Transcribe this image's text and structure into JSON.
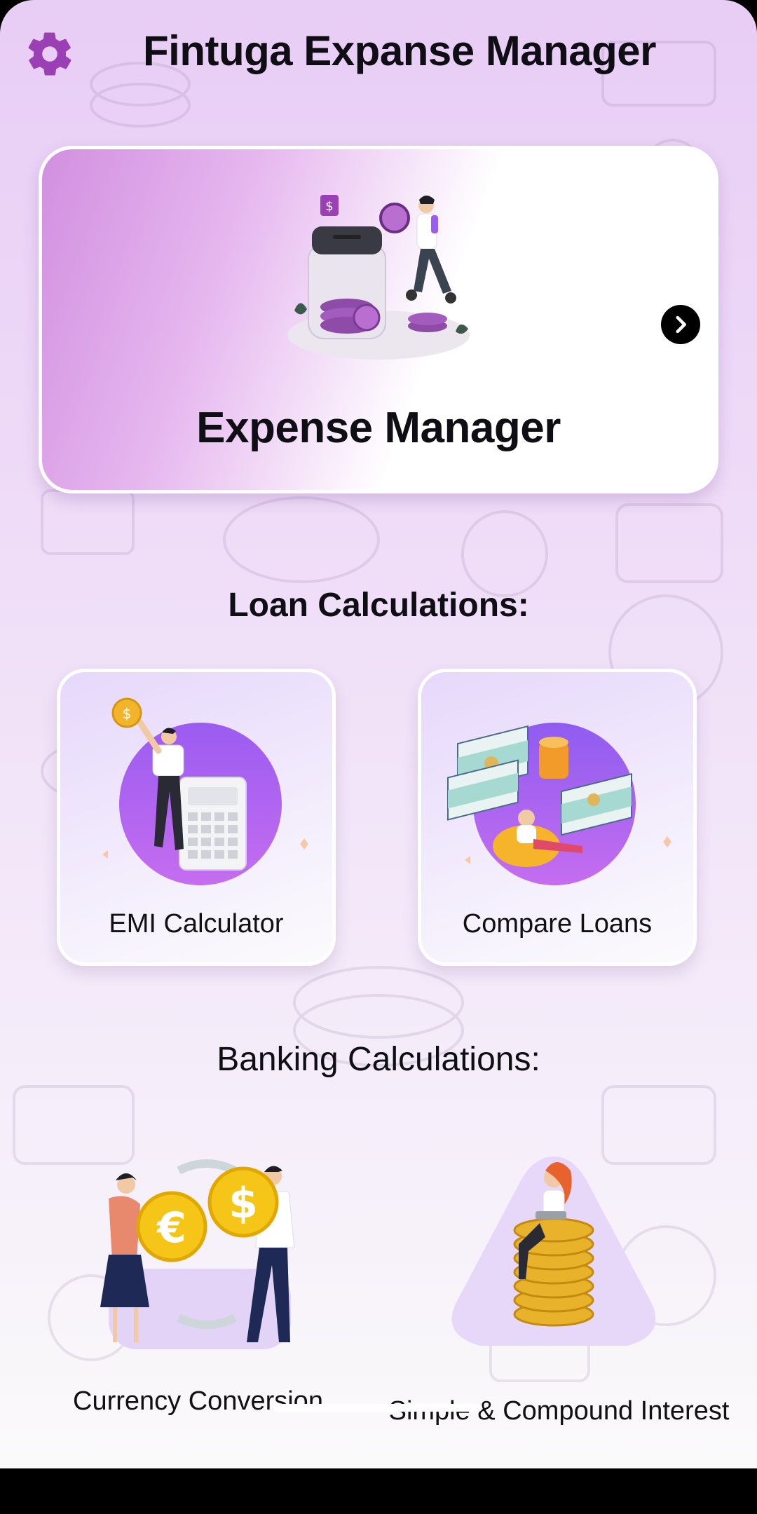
{
  "header": {
    "title": "Fintuga Expanse Manager",
    "settings_icon": "gear-icon"
  },
  "hero": {
    "title": "Expense Manager",
    "illustration": "piggy-jar-coins-illustration",
    "arrow_icon": "chevron-right-icon"
  },
  "loan_section": {
    "title": "Loan Calculations:",
    "items": [
      {
        "label": "EMI Calculator",
        "illustration": "calculator-illustration"
      },
      {
        "label": "Compare Loans",
        "illustration": "money-stacks-illustration"
      }
    ]
  },
  "banking_section": {
    "title": "Banking Calculations:",
    "items": [
      {
        "label": "Currency Conversion",
        "illustration": "euro-dollar-exchange-illustration"
      },
      {
        "label": "Simple & Compound Interest",
        "illustration": "coin-stack-illustration"
      }
    ]
  },
  "colors": {
    "accent": "#9b3fb5",
    "background_top": "#e8cdf5",
    "card_gradient": "#d28fe0",
    "tile_purple": "#9b5cf0"
  }
}
